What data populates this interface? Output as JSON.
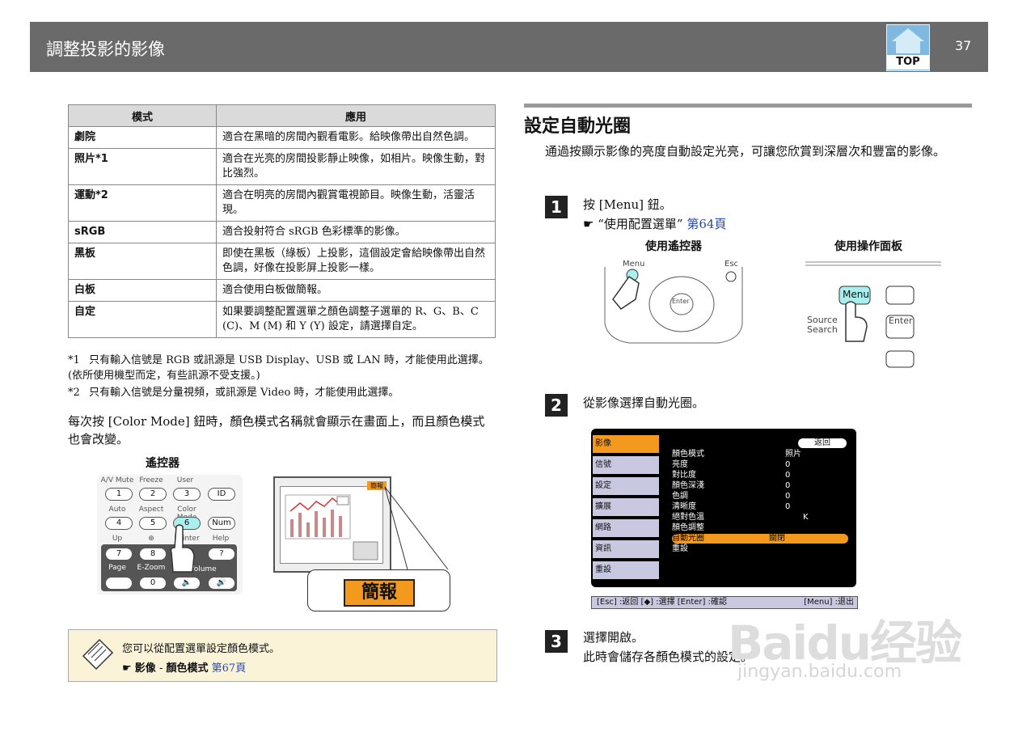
{
  "header": {
    "title": "調整投影的影像",
    "top_label": "TOP",
    "page_number": "37"
  },
  "table": {
    "headers": [
      "模式",
      "應用"
    ],
    "rows": [
      {
        "mode": "劇院",
        "usage": "適合在黑暗的房間內觀看電影。給映像帶出自然色調。"
      },
      {
        "mode": "照片*1",
        "usage": "適合在光亮的房間投影靜止映像，如相片。映像生動，對比強烈。"
      },
      {
        "mode": "運動*2",
        "usage": "適合在明亮的房間內觀賞電視節目。映像生動，活靈活現。"
      },
      {
        "mode": "sRGB",
        "usage": "適合投射符合 sRGB 色彩標準的影像。"
      },
      {
        "mode": "黑板",
        "usage": "即使在黑板（綠板）上投影，這個設定會給映像帶出自然色調，好像在投影屏上投影一樣。"
      },
      {
        "mode": "白板",
        "usage": "適合使用白板做簡報。"
      },
      {
        "mode": "自定",
        "usage": "如果要調整配置選單之顏色調整子選單的 R、G、B、C (C)、M (M) 和 Y (Y) 設定，請選擇自定。"
      }
    ]
  },
  "footnotes": [
    {
      "key": "*1",
      "text": "只有輸入信號是 RGB 或訊源是 USB Display、USB 或 LAN 時，才能使用此選擇。(依所使用機型而定，有些訊源不受支援。)"
    },
    {
      "key": "*2",
      "text": "只有輸入信號是分量視頻，或訊源是 Video 時，才能使用此選擇。"
    }
  ],
  "color_mode_note": "每次按 [Color Mode] 鈕時，顏色模式名稱就會顯示在畫面上，而且顏色模式也會改變。",
  "remote_title": "遙控器",
  "remote": {
    "row1_labels": [
      "A/V Mute",
      "Freeze",
      "User"
    ],
    "row1_keys": [
      "1",
      "2",
      "3",
      "ID"
    ],
    "row2_labels": [
      "Auto",
      "Aspect",
      "Color Mode"
    ],
    "row2_keys": [
      "4",
      "5",
      "6",
      "Num"
    ],
    "row3_labels": [
      "Up",
      "⊕",
      "Pointer",
      "Help"
    ],
    "row3_keys": [
      "7",
      "8",
      "",
      "?"
    ],
    "row4_labels": [
      "Page",
      "E-Zoom",
      "Volume"
    ],
    "row4_keys": [
      "",
      "0",
      "🔈",
      "🔊"
    ]
  },
  "screen_tag": "簡報",
  "callout_tag": "簡報",
  "tip": {
    "line1": "您可以從配置選單設定顏色模式。",
    "line2_prefix": "☛",
    "line2_menu": "影像",
    "line2_sep": "-",
    "line2_item": "顏色模式",
    "line2_link": "第67頁"
  },
  "section": {
    "title": "設定自動光圈",
    "desc": "通過按顯示影像的亮度自動設定光亮，可讓您欣賞到深層次和豐富的影像。"
  },
  "steps": [
    {
      "num": "1",
      "text": "按 [Menu] 鈕。",
      "ref": "☛ “使用配置選單”",
      "link": "第64頁"
    },
    {
      "num": "2",
      "text": "從影像選擇自動光圈。"
    },
    {
      "num": "3",
      "text": "選擇開啟。",
      "sub": "此時會儲存各顏色模式的設定。"
    }
  ],
  "step1_images": {
    "left_title": "使用遙控器",
    "right_title": "使用操作面板",
    "left_labels": [
      "Menu",
      "Esc",
      "Enter"
    ],
    "right_labels": [
      "Menu",
      "Source Search",
      "Enter"
    ]
  },
  "menu": {
    "tabs": [
      "影像",
      "信號",
      "設定",
      "擴展",
      "網路",
      "資訊",
      "重設"
    ],
    "back": "返回",
    "rows": [
      {
        "label": "顏色模式",
        "value": "照片"
      },
      {
        "label": "亮度",
        "value": "0"
      },
      {
        "label": "對比度",
        "value": "0"
      },
      {
        "label": "顏色深淺",
        "value": "0"
      },
      {
        "label": "色調",
        "value": "0"
      },
      {
        "label": "清晰度",
        "value": "0"
      },
      {
        "label": "絕對色溫",
        "value": "K"
      },
      {
        "label": "顏色調整",
        "value": ""
      },
      {
        "label": "自動光圈",
        "value": "關閉"
      },
      {
        "label": "重設",
        "value": ""
      }
    ],
    "footer": "[Esc] :返回 [◆] :選擇 [Enter] :確認",
    "footer_right": "[Menu] :退出"
  },
  "watermark": {
    "main": "Baidu经验",
    "sub": "jingyan.baidu.com"
  }
}
